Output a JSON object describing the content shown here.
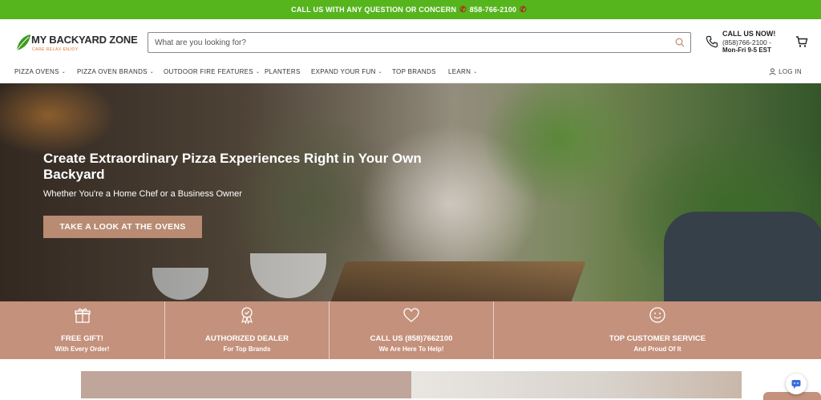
{
  "promo": {
    "text": "CALL US WITH ANY QUESTION OR CONCERN",
    "phone": "858-766-2100"
  },
  "brand": {
    "name": "MY BACKYARD ZONE",
    "tagline": "CARE RELAX ENJOY",
    "leaf_color": "#3f9a1f",
    "tagline_color": "#e0722f"
  },
  "search": {
    "placeholder": "What are you looking for?",
    "value": ""
  },
  "contact": {
    "title": "CALL US NOW!",
    "phone": "(858)766-2100 -",
    "hours": "Mon-Fri 9-5 EST"
  },
  "nav": {
    "items": [
      {
        "label": "PIZZA OVENS",
        "dropdown": true
      },
      {
        "label": "PIZZA OVEN BRANDS",
        "dropdown": true
      },
      {
        "label": "OUTDOOR FIRE FEATURES",
        "dropdown": true
      },
      {
        "label": "PLANTERS",
        "dropdown": false
      },
      {
        "label": "EXPAND YOUR FUN",
        "dropdown": true
      },
      {
        "label": "TOP BRANDS",
        "dropdown": false
      },
      {
        "label": "LEARN",
        "dropdown": true
      }
    ],
    "login": "LOG IN"
  },
  "hero": {
    "title": "Create Extraordinary Pizza Experiences Right in Your Own Backyard",
    "subtitle": "Whether You're a Home Chef or a Business Owner",
    "cta": "TAKE A LOOK AT THE OVENS"
  },
  "features": [
    {
      "icon": "gift-icon",
      "title": "FREE GIFT!",
      "sub": "With Every Order!"
    },
    {
      "icon": "award-ribbon-icon",
      "title": "AUTHORIZED DEALER",
      "sub": "For Top Brands"
    },
    {
      "icon": "heart-icon",
      "title": "CALL US (858)7662100",
      "sub": "We Are Here To Help!"
    },
    {
      "icon": "smiley-icon",
      "title": "TOP CUSTOMER SERVICE",
      "sub": "And Proud Of It"
    }
  ],
  "colors": {
    "promo_bg": "#56b51d",
    "accent": "#c4917c",
    "button": "#b88b72"
  }
}
